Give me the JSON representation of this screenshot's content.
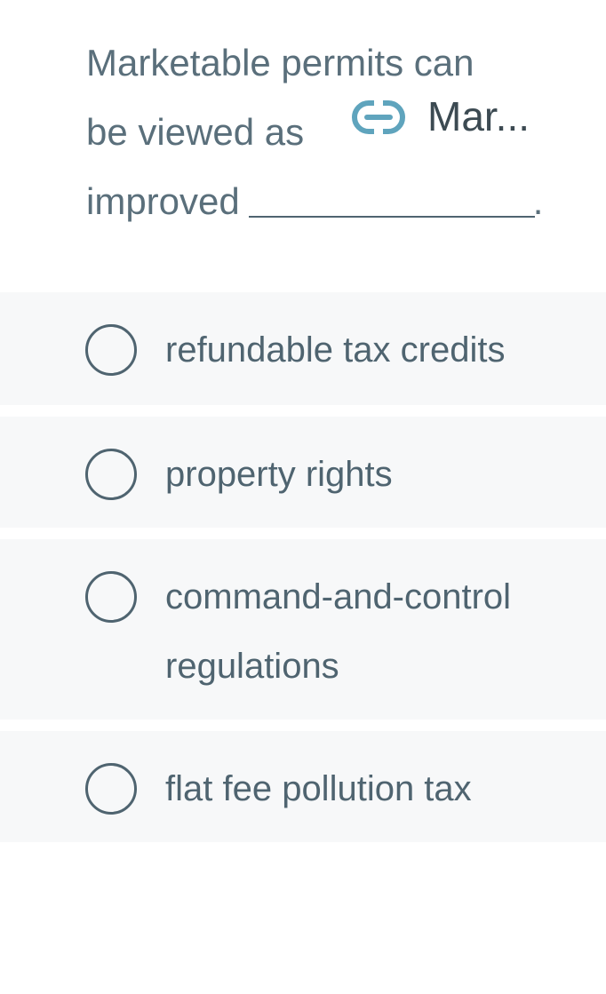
{
  "question": {
    "line1": "Marketable permits can",
    "line2": "be viewed as",
    "line3": "improved",
    "period": ".",
    "link_text": "Mar..."
  },
  "options": [
    {
      "label": "refundable tax credits"
    },
    {
      "label": "property rights"
    },
    {
      "label": "command-and-control regulations"
    },
    {
      "label": "flat fee pollution tax"
    }
  ],
  "colors": {
    "text": "#4f6470",
    "link_icon": "#5fa4bd",
    "option_bg": "#f7f8f9"
  },
  "icons": {
    "link": "link-icon",
    "radio": "radio-unselected-icon"
  }
}
